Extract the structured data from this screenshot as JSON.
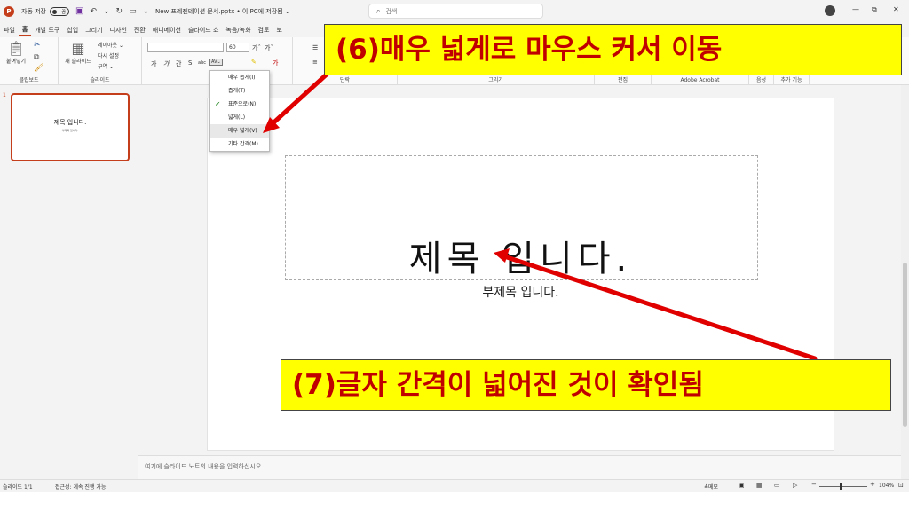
{
  "titlebar": {
    "app_logo": "P",
    "autosave_label": "자동 저장",
    "autosave_state": "끔",
    "doc_title": "New 프레젠테이션 문서.pptx • 이 PC에 저장됨 ⌄",
    "search_placeholder": "검색",
    "window_controls": [
      "—",
      "⧉",
      "✕"
    ],
    "icons": [
      "powerpoint-logo-icon",
      "save-icon",
      "undo-icon",
      "redo-icon",
      "customize-qat-icon"
    ]
  },
  "tabs": [
    "파일",
    "홈",
    "개발 도구",
    "삽입",
    "그리기",
    "디자인",
    "전환",
    "애니메이션",
    "슬라이드 쇼",
    "녹음/녹화",
    "검토",
    "보"
  ],
  "active_tab": "홈",
  "ribbon": {
    "clipboard": {
      "paste": "붙여넣기",
      "label": "클립보드"
    },
    "slides": {
      "new_slide": "새 슬라이드",
      "layout": "레이아웃 ⌄",
      "reset": "다시 설정",
      "section": "구역 ⌄",
      "label": "슬라이드"
    },
    "font": {
      "size": "60",
      "grow": "가ˆ",
      "shrink": "가ˇ",
      "bold": "가",
      "italic": "가",
      "underline": "간",
      "strike": "S",
      "shadow": "abc",
      "spacing": "AV⌄"
    },
    "groups": [
      "단락",
      "그리기",
      "편집",
      "Adobe Acrobat",
      "음성",
      "추가 기능"
    ]
  },
  "spacing_menu": {
    "items": [
      "매우 좁게(I)",
      "좁게(T)",
      "표준으로(N)",
      "넓게(L)",
      "매우 넓게(V)",
      "기타 간격(M)..."
    ],
    "checked_index": 2,
    "hover_index": 4
  },
  "thumbnail": {
    "number": "1",
    "title": "제목 입니다.",
    "subtitle": "부제목 입니다."
  },
  "slide": {
    "title": "제목 입니다.",
    "subtitle": "부제목 입니다."
  },
  "notes_placeholder": "여기에 슬라이드 노트의 내용을 입력하십시오",
  "statusbar": {
    "slide_count": "슬라이드 1/1",
    "accessibility": "접근성: 계속 진행 가능",
    "notes": "≜메모",
    "zoom": "104%"
  },
  "callouts": {
    "step6": "(6)매우 넓게로 마우스 커서 이동",
    "step7": "(7)글자 간격이 넓어진 것이 확인됨"
  },
  "colors": {
    "accent": "#c43e1c",
    "callout_bg": "#ffff00",
    "callout_text": "#c00000",
    "arrow": "#e00000"
  }
}
